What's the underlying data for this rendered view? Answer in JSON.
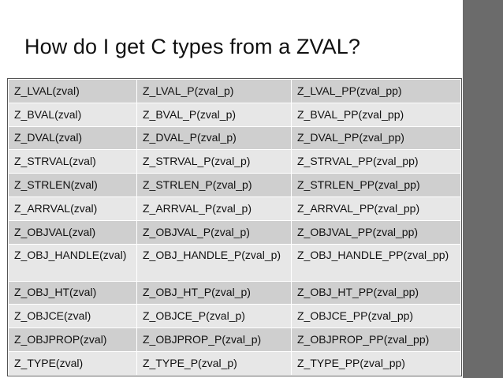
{
  "title": "How do I get C types from a ZVAL?",
  "rows": [
    [
      "Z_LVAL(zval)",
      "Z_LVAL_P(zval_p)",
      "Z_LVAL_PP(zval_pp)"
    ],
    [
      "Z_BVAL(zval)",
      "Z_BVAL_P(zval_p)",
      "Z_BVAL_PP(zval_pp)"
    ],
    [
      "Z_DVAL(zval)",
      "Z_DVAL_P(zval_p)",
      "Z_DVAL_PP(zval_pp)"
    ],
    [
      "Z_STRVAL(zval)",
      "Z_STRVAL_P(zval_p)",
      "Z_STRVAL_PP(zval_pp)"
    ],
    [
      "Z_STRLEN(zval)",
      "Z_STRLEN_P(zval_p)",
      "Z_STRLEN_PP(zval_pp)"
    ],
    [
      "Z_ARRVAL(zval)",
      "Z_ARRVAL_P(zval_p)",
      "Z_ARRVAL_PP(zval_pp)"
    ],
    [
      "Z_OBJVAL(zval)",
      "Z_OBJVAL_P(zval_p)",
      "Z_OBJVAL_PP(zval_pp)"
    ],
    [
      "Z_OBJ_HANDLE(zval)",
      "Z_OBJ_HANDLE_P(zval_p)",
      "Z_OBJ_HANDLE_PP(zval_pp)"
    ],
    [
      "Z_OBJ_HT(zval)",
      "Z_OBJ_HT_P(zval_p)",
      "Z_OBJ_HT_PP(zval_pp)"
    ],
    [
      "Z_OBJCE(zval)",
      "Z_OBJCE_P(zval_p)",
      "Z_OBJCE_PP(zval_pp)"
    ],
    [
      "Z_OBJPROP(zval)",
      "Z_OBJPROP_P(zval_p)",
      "Z_OBJPROP_PP(zval_pp)"
    ],
    [
      "Z_TYPE(zval)",
      "Z_TYPE_P(zval_p)",
      "Z_TYPE_PP(zval_pp)"
    ]
  ],
  "colors": {
    "row_dark": "#cfcfcf",
    "row_light": "#e7e7e7",
    "side_bar": "#6b6b6b"
  }
}
